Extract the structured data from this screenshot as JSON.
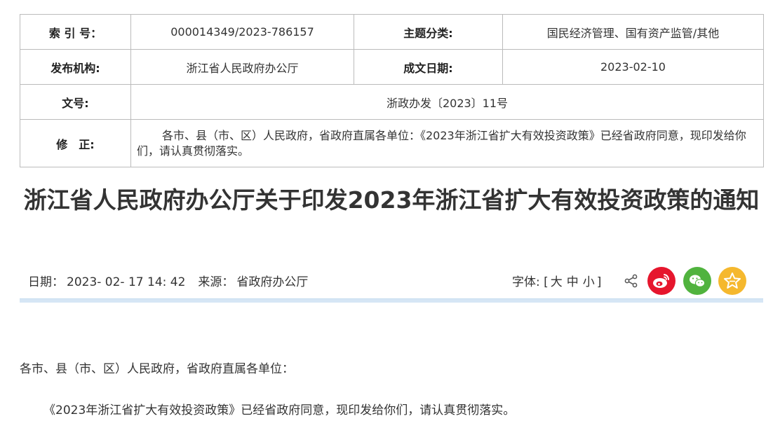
{
  "meta": {
    "index_label": "索 引 号：",
    "index_value": "000014349/2023-786157",
    "topic_label": "主题分类:",
    "topic_value": "国民经济管理、国有资产监管/其他",
    "issuer_label": "发布机构:",
    "issuer_value": "浙江省人民政府办公厅",
    "date_label": "成文日期:",
    "date_value": "2023-02-10",
    "docno_label": "文号:",
    "docno_value": "浙政办发〔2023〕11号",
    "correction_label": "修　正:",
    "correction_value": "各市、县（市、区）人民政府，省政府直属各单位：《2023年浙江省扩大有效投资政策》已经省政府同意，现印发给你们，请认真贯彻落实。"
  },
  "article": {
    "title": "浙江省人民政府办公厅关于印发2023年浙江省扩大有效投资政策的通知",
    "date_label": "日期：",
    "date_value": "2023- 02- 17 14: 42",
    "source_label": "来源：",
    "source_value": "省政府办公厅",
    "font_label": "字体:",
    "font_open": "[",
    "font_large": "大",
    "font_medium": "中",
    "font_small": "小",
    "font_close": "]",
    "paragraph1": "各市、县（市、区）人民政府，省政府直属各单位：",
    "paragraph2": "《2023年浙江省扩大有效投资政策》已经省政府同意，现印发给你们，请认真贯彻落实。"
  },
  "icons": {
    "share": "share-icon",
    "weibo": "weibo-icon",
    "wechat": "wechat-icon",
    "favorite": "star-icon"
  },
  "colors": {
    "weibo": "#e6162d",
    "wechat": "#50b33e",
    "favorite": "#f5b82e",
    "divider": "#d6e6f5"
  }
}
